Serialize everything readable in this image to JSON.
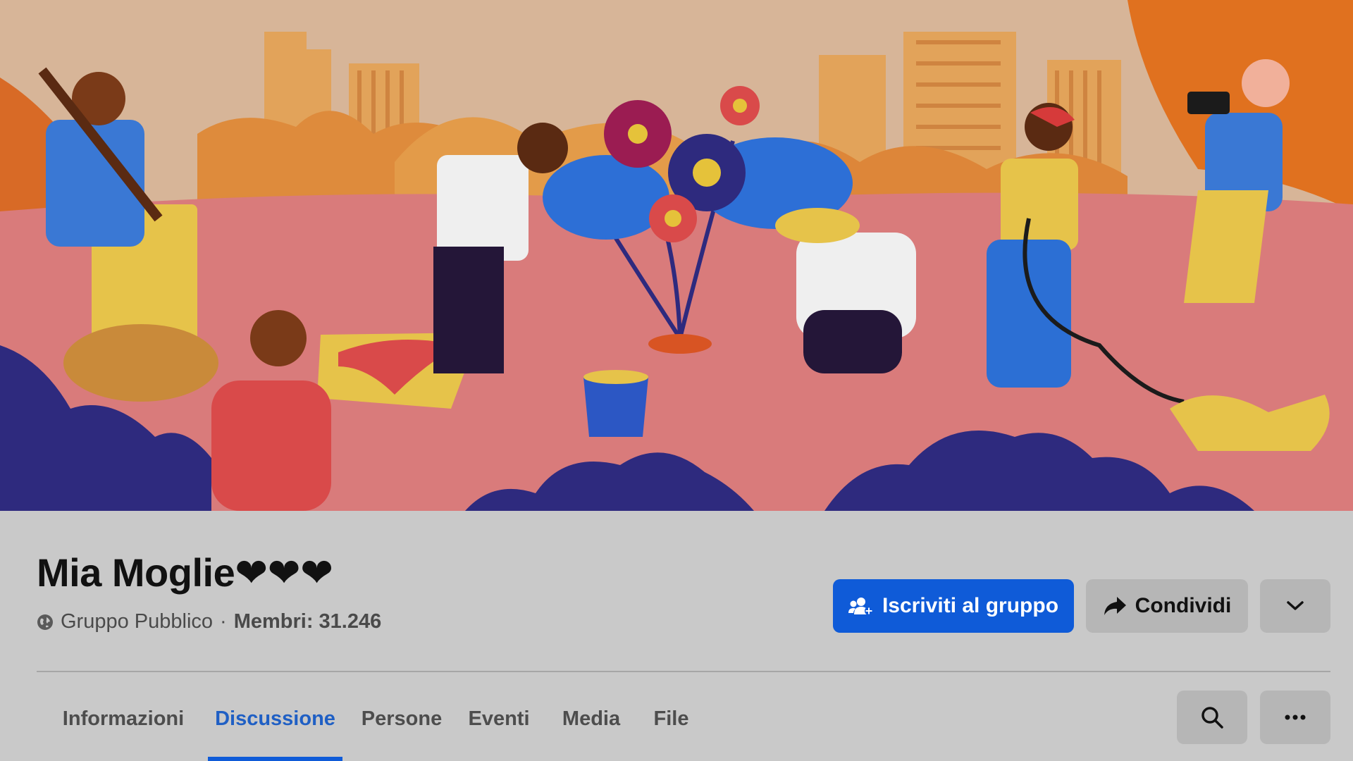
{
  "group": {
    "title": "Mia Moglie❤❤❤",
    "privacy": "Gruppo Pubblico",
    "separator": "·",
    "members": "Membri: 31.246"
  },
  "actions": {
    "join_label": "Iscriviti al gruppo",
    "share_label": "Condividi"
  },
  "tabs": [
    {
      "label": "Informazioni",
      "active": false
    },
    {
      "label": "Discussione",
      "active": true
    },
    {
      "label": "Persone",
      "active": false
    },
    {
      "label": "Eventi",
      "active": false
    },
    {
      "label": "Media",
      "active": false
    },
    {
      "label": "File",
      "active": false
    }
  ],
  "icons": {
    "privacy": "globe-icon",
    "join": "group-add-icon",
    "share": "share-arrow-icon",
    "more": "chevron-down-icon",
    "search": "search-icon",
    "overflow": "ellipsis-icon"
  },
  "colors": {
    "primary": "#0f5bd8",
    "active_tab": "#1f5fc4",
    "header_bg": "#c9c9c9"
  }
}
